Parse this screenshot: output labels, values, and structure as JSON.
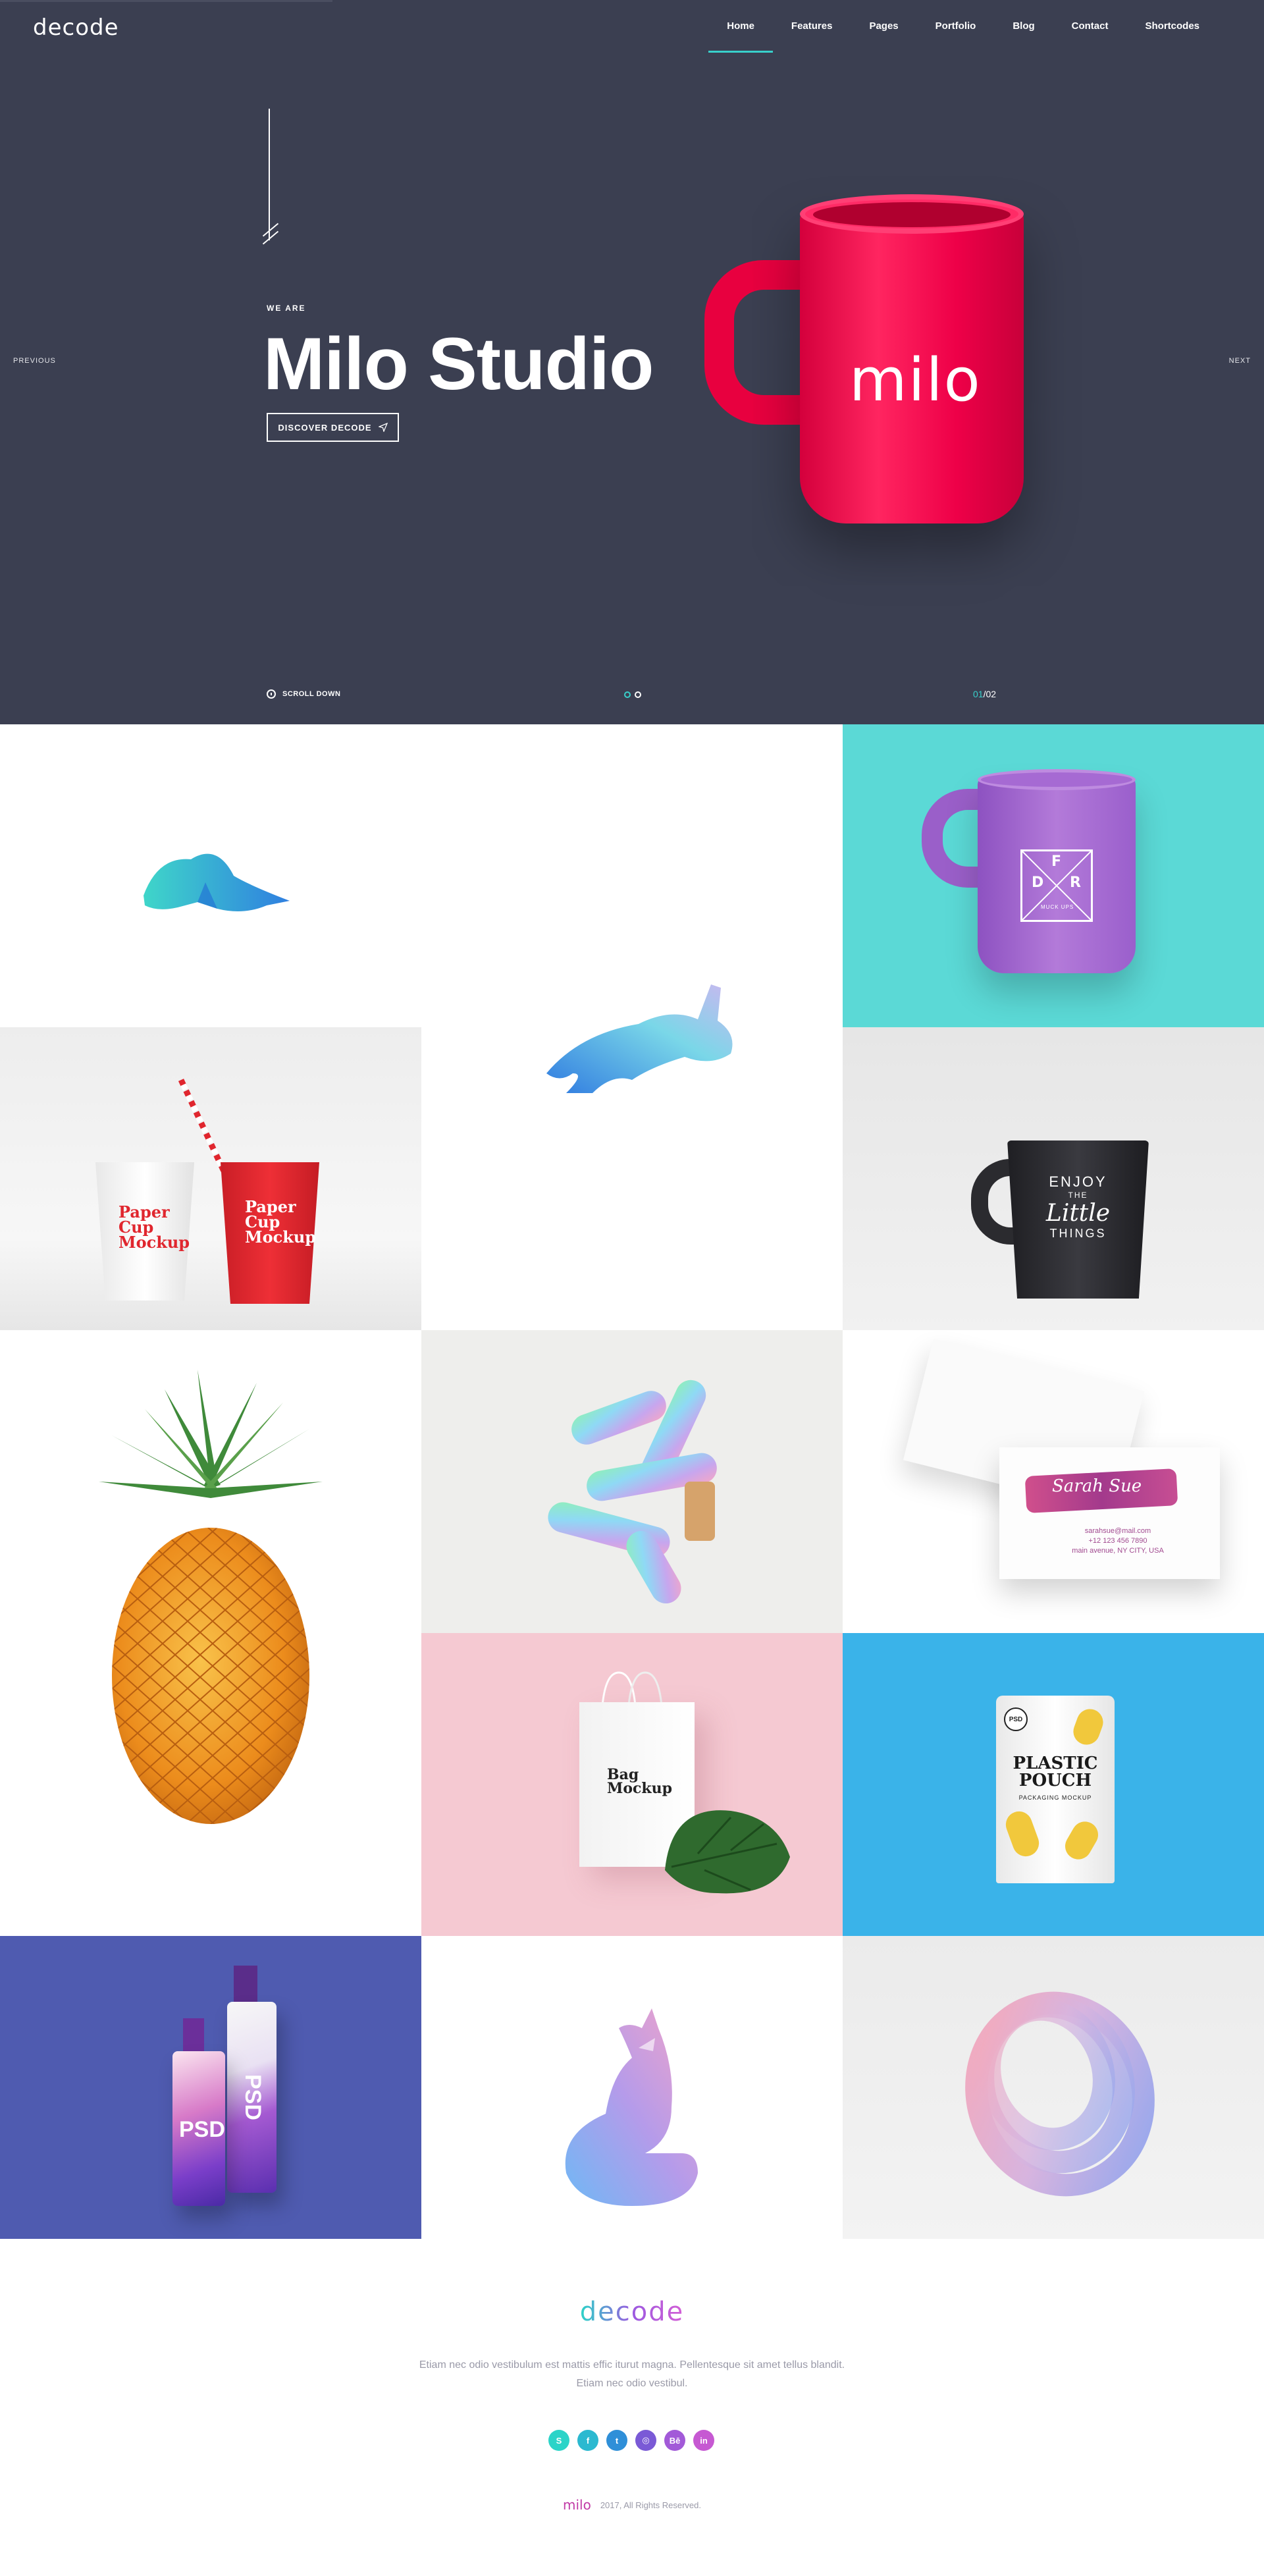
{
  "brand": {
    "logo": "decode"
  },
  "nav": {
    "items": [
      {
        "label": "Home",
        "active": true
      },
      {
        "label": "Features"
      },
      {
        "label": "Pages"
      },
      {
        "label": "Portfolio"
      },
      {
        "label": "Blog"
      },
      {
        "label": "Contact"
      },
      {
        "label": "Shortcodes"
      }
    ]
  },
  "hero": {
    "eyebrow": "WE ARE",
    "title": "Milo Studio",
    "cta_label": "DISCOVER DECODE",
    "prev_label": "PREVIOUS",
    "next_label": "NEXT",
    "mug_text": "milo",
    "scroll_label": "SCROLL DOWN",
    "slide_current": "01",
    "slide_total": "/02",
    "accent_color": "#38d0cb",
    "background_color": "#3b3f51"
  },
  "portfolio": {
    "tiles": [
      {
        "name": "fox-logo",
        "bg": "#ffffff"
      },
      {
        "name": "rabbit-logo",
        "bg": "#ffffff"
      },
      {
        "name": "purple-mug",
        "bg": "#5bd9d6",
        "mug_letters": [
          "F",
          "D",
          "R"
        ],
        "mug_sub": "MUCK UPS"
      },
      {
        "name": "paper-cups",
        "bg": "#f4f4f4",
        "cup_text": [
          "Paper",
          "Cup",
          "Mockup"
        ]
      },
      {
        "name": "black-mug",
        "bg": "#e9e9e9",
        "mug_text": [
          "ENJOY",
          "THE",
          "Little",
          "THINGS"
        ]
      },
      {
        "name": "pineapple",
        "bg": "#ffffff"
      },
      {
        "name": "gradient-shape",
        "bg": "#eeeeec"
      },
      {
        "name": "business-cards",
        "bg": "#ffffff",
        "card_name": "Sarah Sue",
        "card_lines": [
          "sarahsue@mail.com",
          "+12 123 456 7890",
          "main avenue, NY CITY, USA"
        ]
      },
      {
        "name": "bag-mockup",
        "bg": "#f5c9d2",
        "bag_text": [
          "Bag",
          "Mockup"
        ]
      },
      {
        "name": "plastic-pouch",
        "bg": "#3ab3e9",
        "pouch_text": [
          "PLASTIC",
          "POUCH"
        ],
        "pouch_sub": "PACKAGING MOCKUP",
        "pouch_badge": "PSD"
      },
      {
        "name": "spray-bottles",
        "bg": "#4f5bb0",
        "bottle_text": "PSD"
      },
      {
        "name": "gradient-fox",
        "bg": "#ffffff"
      },
      {
        "name": "gradient-rings",
        "bg": "#eeeeee"
      }
    ]
  },
  "footer": {
    "logo": "decode",
    "text_line1": "Etiam nec odio vestibulum est mattis effic iturut magna. Pellentesque sit amet tellus blandit.",
    "text_line2": "Etiam nec odio vestibul.",
    "socials": [
      {
        "icon": "skype-icon",
        "glyph": "S",
        "color": "#2cd4c8"
      },
      {
        "icon": "facebook-icon",
        "glyph": "f",
        "color": "#2bb9d0"
      },
      {
        "icon": "twitter-icon",
        "glyph": "t",
        "color": "#2f8fd8"
      },
      {
        "icon": "dribbble-icon",
        "glyph": "◎",
        "color": "#7a5ad6"
      },
      {
        "icon": "behance-icon",
        "glyph": "Bē",
        "color": "#a25ad8"
      },
      {
        "icon": "linkedin-icon",
        "glyph": "in",
        "color": "#c659d2"
      }
    ],
    "copyright_logo": "milo",
    "copyright": "2017, All Rights Reserved."
  }
}
